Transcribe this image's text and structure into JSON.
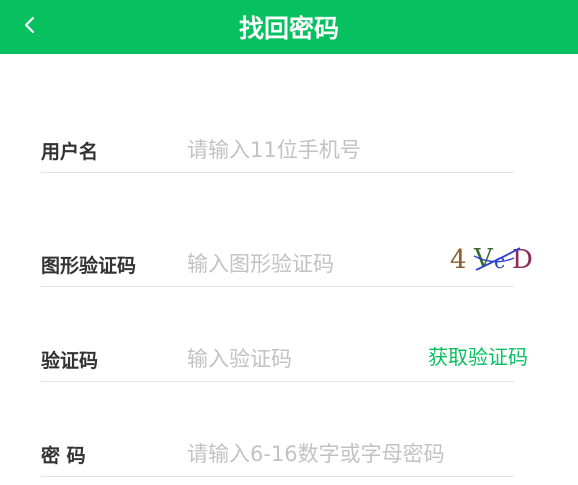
{
  "header": {
    "title": "找回密码"
  },
  "form": {
    "username": {
      "label": "用户名",
      "placeholder": "请输入11位手机号"
    },
    "captcha": {
      "label": "图形验证码",
      "placeholder": "输入图形验证码",
      "image_text": "4VcD"
    },
    "verify_code": {
      "label": "验证码",
      "placeholder": "输入验证码",
      "get_code_label": "获取验证码"
    },
    "password": {
      "label": "密 码",
      "placeholder": "请输入6-16数字或字母密码"
    }
  },
  "colors": {
    "accent": "#07c160",
    "label": "#333333",
    "placeholder": "#c2c2c2",
    "divider": "#e4e4e4"
  }
}
